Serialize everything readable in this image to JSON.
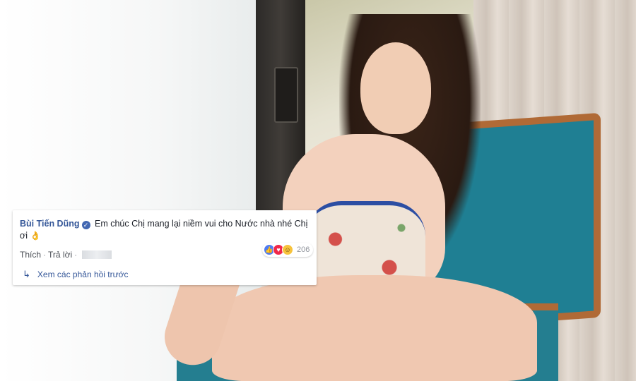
{
  "comment": {
    "author": "Bùi Tiến Dũng",
    "text": "Em chúc Chị mang lại niềm vui cho Nước nhà nhé Chị ơi",
    "emoji": "👌",
    "verified_icon": "verified-badge-icon",
    "like_label": "Thích",
    "reply_label": "Trả lời",
    "reaction_count": "206",
    "reactions": [
      "like",
      "love",
      "haha"
    ],
    "view_replies_label": "Xem các phản hồi trước"
  },
  "colors": {
    "author_link": "#365899",
    "like": "#4d7bf3",
    "love": "#f0284a",
    "haha": "#f7c33c"
  }
}
